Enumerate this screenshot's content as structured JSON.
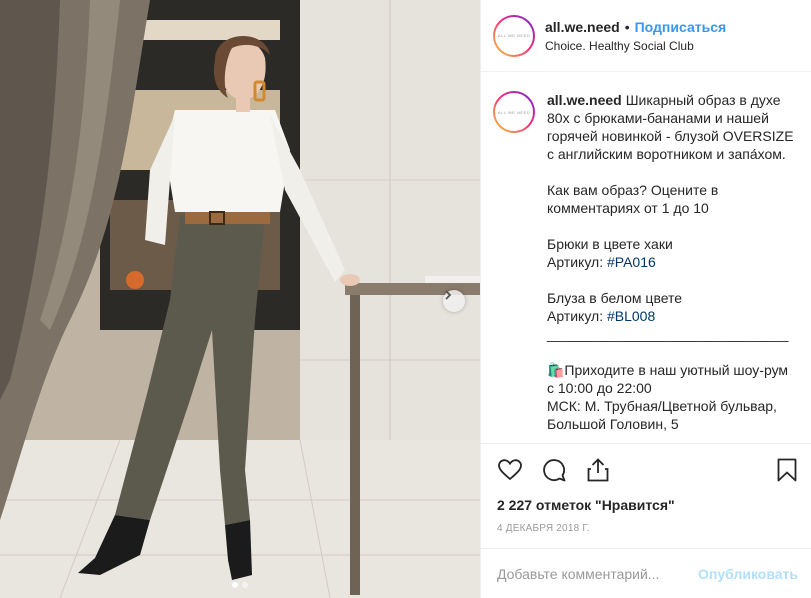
{
  "post": {
    "username": "all.we.need",
    "bullet": "•",
    "follow_label": "Подписаться",
    "location": "Choice. Healthy Social Club",
    "avatar_text": "ALL WE NEED"
  },
  "caption": {
    "username": "all.we.need",
    "text_1": "Шикарный образ в духе 80х с брюками-бананами и нашей горячей новинкой - блузой OVERSIZE с английским воротником и запа́хом.\n\nКак вам образ? Оцените в комментариях от 1 до 10\n\nБрюки в цвете хаки\nАртикул: ",
    "tag_1": "#PA016",
    "text_2": "\n\nБлуза в белом цвете\nАртикул: ",
    "tag_2": "#BL008",
    "text_3": "\n_______________________________\n\n🛍️Приходите в наш уютный шоу-рум с 10:00 до 22:00\nМСК: М. Трубная/Цветной бульвар, Большой Головин, 5"
  },
  "actions": {
    "likes": "2 227 отметок \"Нравится\"",
    "date": "4 декабря 2018 г."
  },
  "comment_box": {
    "placeholder": "Добавьте комментарий...",
    "post_label": "Опубликовать"
  },
  "carousel": {
    "count": 2,
    "active": 0
  },
  "colors": {
    "link": "#3897f0",
    "hashtag": "#003569",
    "post_disabled": "#b2dffc"
  },
  "icons": [
    "heart-icon",
    "comment-icon",
    "share-icon",
    "bookmark-icon",
    "chevron-right-icon"
  ]
}
